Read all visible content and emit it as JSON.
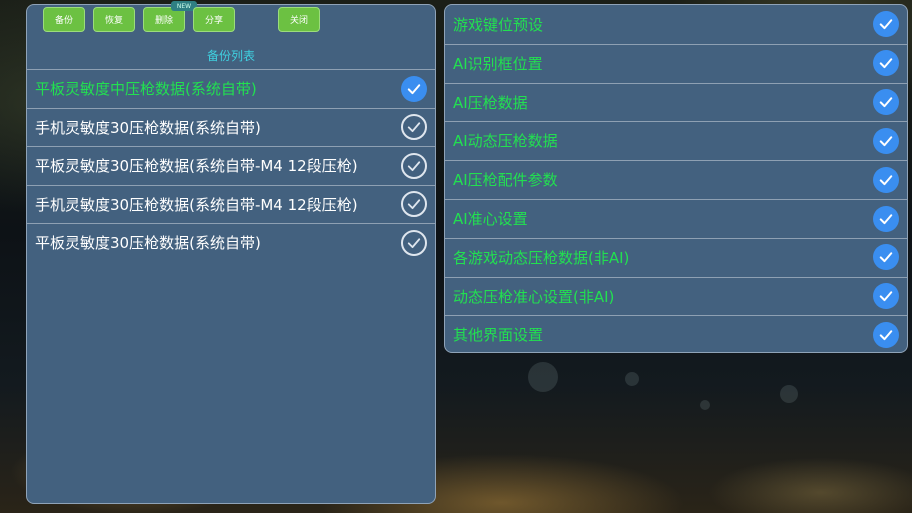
{
  "toolbar": {
    "backup": "备份",
    "restore": "恢复",
    "delete": "删除",
    "share": "分享",
    "close": "关闭",
    "badge": "NEW"
  },
  "backup_list": {
    "title": "备份列表",
    "items": [
      {
        "label": "平板灵敏度中压枪数据(系统自带)",
        "checked": true
      },
      {
        "label": "手机灵敏度30压枪数据(系统自带)",
        "checked": false
      },
      {
        "label": "平板灵敏度30压枪数据(系统自带-M4 12段压枪)",
        "checked": false
      },
      {
        "label": "手机灵敏度30压枪数据(系统自带-M4 12段压枪)",
        "checked": false
      },
      {
        "label": "平板灵敏度30压枪数据(系统自带)",
        "checked": false
      }
    ]
  },
  "options": {
    "items": [
      {
        "label": "游戏键位预设",
        "checked": true
      },
      {
        "label": "AI识别框位置",
        "checked": true
      },
      {
        "label": "AI压枪数据",
        "checked": true
      },
      {
        "label": "AI动态压枪数据",
        "checked": true
      },
      {
        "label": "AI压枪配件参数",
        "checked": true
      },
      {
        "label": "AI准心设置",
        "checked": true
      },
      {
        "label": "各游戏动态压枪数据(非AI)",
        "checked": true
      },
      {
        "label": "动态压枪准心设置(非AI)",
        "checked": true
      },
      {
        "label": "其他界面设置",
        "checked": true
      }
    ]
  },
  "colors": {
    "panel": "#43617f",
    "accent_green": "#22e050",
    "check_blue": "#3a8ef0",
    "button_green": "#6cc142"
  }
}
